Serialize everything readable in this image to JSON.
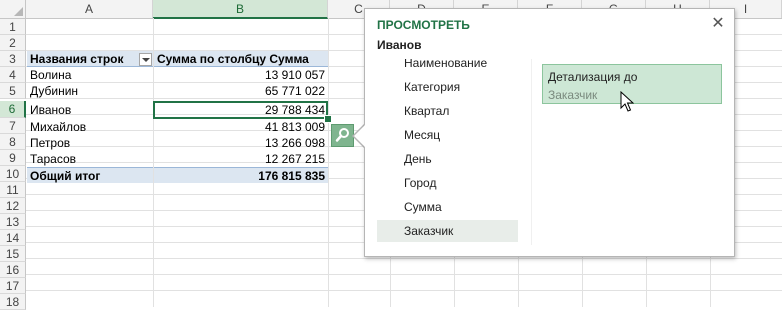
{
  "columns": [
    "A",
    "B",
    "C",
    "D",
    "E",
    "F",
    "G",
    "H",
    "I"
  ],
  "rows": [
    "1",
    "2",
    "3",
    "4",
    "5",
    "6",
    "7",
    "8",
    "9",
    "10",
    "11",
    "12",
    "13",
    "14",
    "15",
    "16",
    "17",
    "18"
  ],
  "pivot": {
    "row_header": "Названия строк",
    "value_header": "Сумма по столбцу Сумма",
    "data": [
      {
        "name": "Волина",
        "value": "13 910 057"
      },
      {
        "name": "Дубинин",
        "value": "65 771 022"
      },
      {
        "name": "Иванов",
        "value": "29 788 434"
      },
      {
        "name": "Михайлов",
        "value": "41 813 009"
      },
      {
        "name": "Петров",
        "value": "13 266 098"
      },
      {
        "name": "Тарасов",
        "value": "12 267 215"
      }
    ],
    "total_label": "Общий итог",
    "total_value": "176 815 835"
  },
  "selection": {
    "column": "B",
    "row": "6"
  },
  "quick_explore": {
    "title": "ПРОСМОТРЕТЬ",
    "subtitle": "Иванов",
    "close": "✕",
    "fields": [
      "Наименование",
      "Категория",
      "Квартал",
      "Месяц",
      "День",
      "Город",
      "Сумма",
      "Заказчик"
    ],
    "selected_field": "Заказчик",
    "drill_label": "Детализация до",
    "drill_target": "Заказчик"
  },
  "colors": {
    "accent": "#217346",
    "pivot_header": "#dce6f1",
    "drill_bg": "#cde7d5"
  },
  "icons": {
    "quick_explore": "magnifier-icon",
    "filter": "filter-dropdown-icon",
    "cursor": "mouse-pointer-icon"
  }
}
